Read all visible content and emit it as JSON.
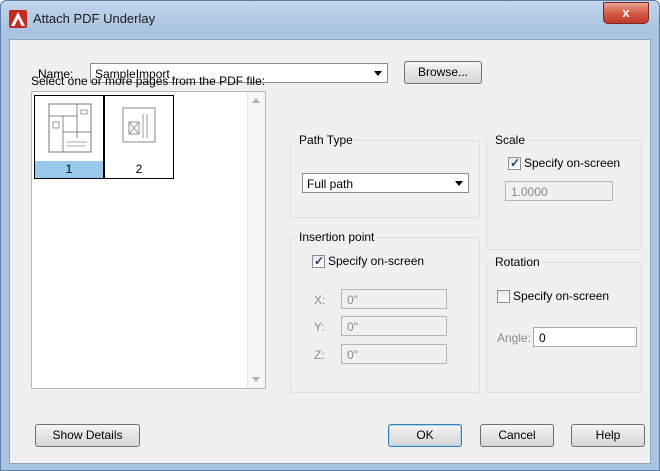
{
  "window": {
    "title": "Attach PDF Underlay",
    "close_glyph": "x"
  },
  "name_row": {
    "label": "Name:",
    "value": "SampleImport",
    "browse_label": "Browse..."
  },
  "pages": {
    "instruction": "Select one or more pages from the PDF file:",
    "items": [
      {
        "number": "1",
        "selected": true
      },
      {
        "number": "2",
        "selected": false
      }
    ]
  },
  "path_type": {
    "title": "Path Type",
    "value": "Full path"
  },
  "scale": {
    "title": "Scale",
    "specify_label": "Specify on-screen",
    "specify_checked": true,
    "value": "1.0000"
  },
  "insertion": {
    "title": "Insertion point",
    "specify_label": "Specify on-screen",
    "specify_checked": true,
    "x_label": "X:",
    "x_value": "0\"",
    "y_label": "Y:",
    "y_value": "0\"",
    "z_label": "Z:",
    "z_value": "0\""
  },
  "rotation": {
    "title": "Rotation",
    "specify_label": "Specify on-screen",
    "specify_checked": false,
    "angle_label": "Angle:",
    "angle_value": "0"
  },
  "buttons": {
    "show_details": "Show Details",
    "ok": "OK",
    "cancel": "Cancel",
    "help": "Help"
  },
  "colors": {
    "title_bar": "#a9c3e2",
    "close_button": "#c0392b",
    "selected_page": "#99c9ea"
  },
  "icons": {
    "app": "autocad-icon",
    "close": "close-icon",
    "dropdown": "chevron-down-icon",
    "checkbox": "checkmark-icon"
  }
}
